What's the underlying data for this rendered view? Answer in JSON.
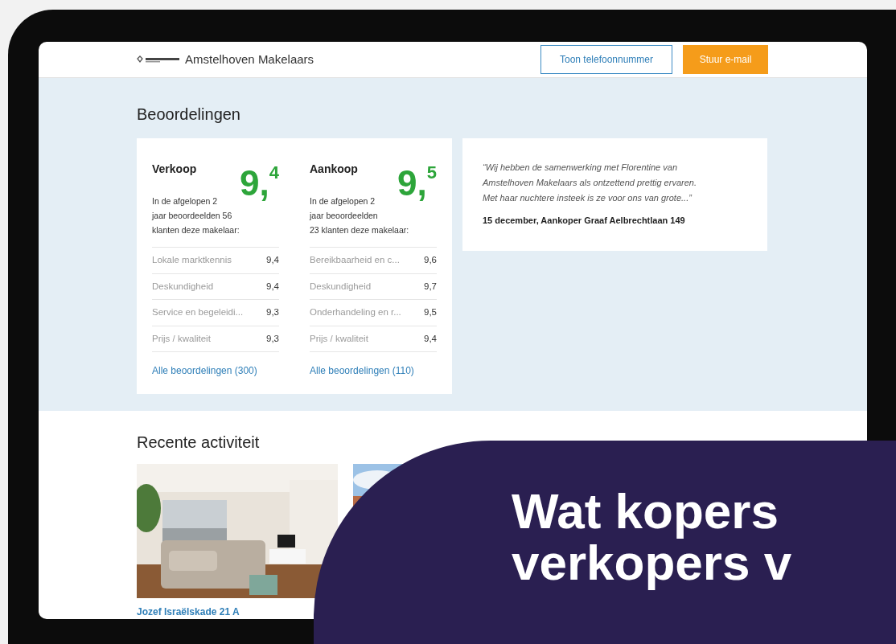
{
  "header": {
    "brand": "Amstelhoven Makelaars",
    "buttons": [
      {
        "label": "Toon telefoonnummer",
        "kind": "outline"
      },
      {
        "label": "Stuur e-mail",
        "kind": "primary"
      }
    ]
  },
  "reviews": {
    "title": "Beoordelingen",
    "groups": [
      {
        "title": "Verkoop",
        "score_whole": "9,",
        "score_decimal": "4",
        "lines": [
          "In de afgelopen 2",
          "jaar beoordeelden 56",
          "klanten deze makelaar:"
        ],
        "items": [
          {
            "label": "Lokale marktkennis",
            "value": "9,4"
          },
          {
            "label": "Deskundigheid",
            "value": "9,4"
          },
          {
            "label": "Service en begeleidi...",
            "value": "9,3"
          },
          {
            "label": "Prijs / kwaliteit",
            "value": "9,3"
          }
        ],
        "link": "Alle beoordelingen (300)"
      },
      {
        "title": "Aankoop",
        "score_whole": "9,",
        "score_decimal": "5",
        "lines": [
          "In de afgelopen 2",
          "jaar beoordeelden",
          "23 klanten deze makelaar:"
        ],
        "items": [
          {
            "label": "Bereikbaarheid en c...",
            "value": "9,6"
          },
          {
            "label": "Deskundigheid",
            "value": "9,7"
          },
          {
            "label": "Onderhandeling en r...",
            "value": "9,5"
          },
          {
            "label": "Prijs / kwaliteit",
            "value": "9,4"
          }
        ],
        "link": "Alle beoordelingen (110)"
      }
    ],
    "quote": {
      "lines": [
        "“Wij hebben de samenwerking met Florentine van",
        "Amstelhoven Makelaars als ontzettend prettig ervaren.",
        "Met haar nuchtere insteek is ze voor ons van grote...”"
      ],
      "author": "15 december, Aankoper Graaf Aelbrechtlaan 149"
    }
  },
  "activity": {
    "title": "Recente activiteit",
    "listings": [
      {
        "kind": "picture",
        "address": "Jozef Israëlskade 21 A"
      },
      {
        "kind": "picture"
      }
    ]
  },
  "banner": {
    "lines": [
      "Wat kopers",
      "verkopers v"
    ]
  }
}
